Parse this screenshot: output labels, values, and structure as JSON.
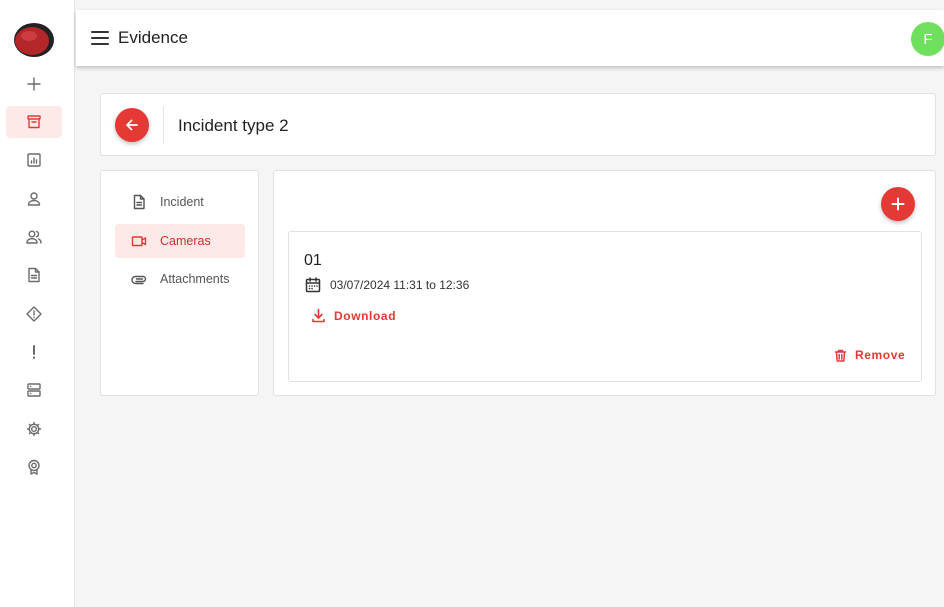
{
  "header": {
    "title": "Evidence",
    "avatar_initial": "F",
    "avatar_color": "#6ee05d"
  },
  "theme": {
    "accent": "#e53935",
    "accent_light": "#fde9e8"
  },
  "rail": {
    "items": [
      {
        "icon": "plus-icon",
        "active": false
      },
      {
        "icon": "archive-icon",
        "active": true
      },
      {
        "icon": "report-chart-icon",
        "active": false
      },
      {
        "icon": "user-icon",
        "active": false
      },
      {
        "icon": "users-icon",
        "active": false
      },
      {
        "icon": "document-icon",
        "active": false
      },
      {
        "icon": "warning-diamond-icon",
        "active": false
      },
      {
        "icon": "exclamation-icon",
        "active": false
      },
      {
        "icon": "server-icon",
        "active": false
      },
      {
        "icon": "settings-icon",
        "active": false
      },
      {
        "icon": "badge-icon",
        "active": false
      }
    ]
  },
  "incident": {
    "title": "Incident type 2"
  },
  "side_nav": {
    "items": [
      {
        "label": "Incident",
        "icon": "document-icon",
        "active": false
      },
      {
        "label": "Cameras",
        "icon": "video-camera-icon",
        "active": true
      },
      {
        "label": "Attachments",
        "icon": "paperclip-icon",
        "active": false
      }
    ]
  },
  "recording": {
    "id": "01",
    "date_range": "03/07/2024 11:31 to 12:36",
    "download_label": "Download",
    "remove_label": "Remove"
  }
}
